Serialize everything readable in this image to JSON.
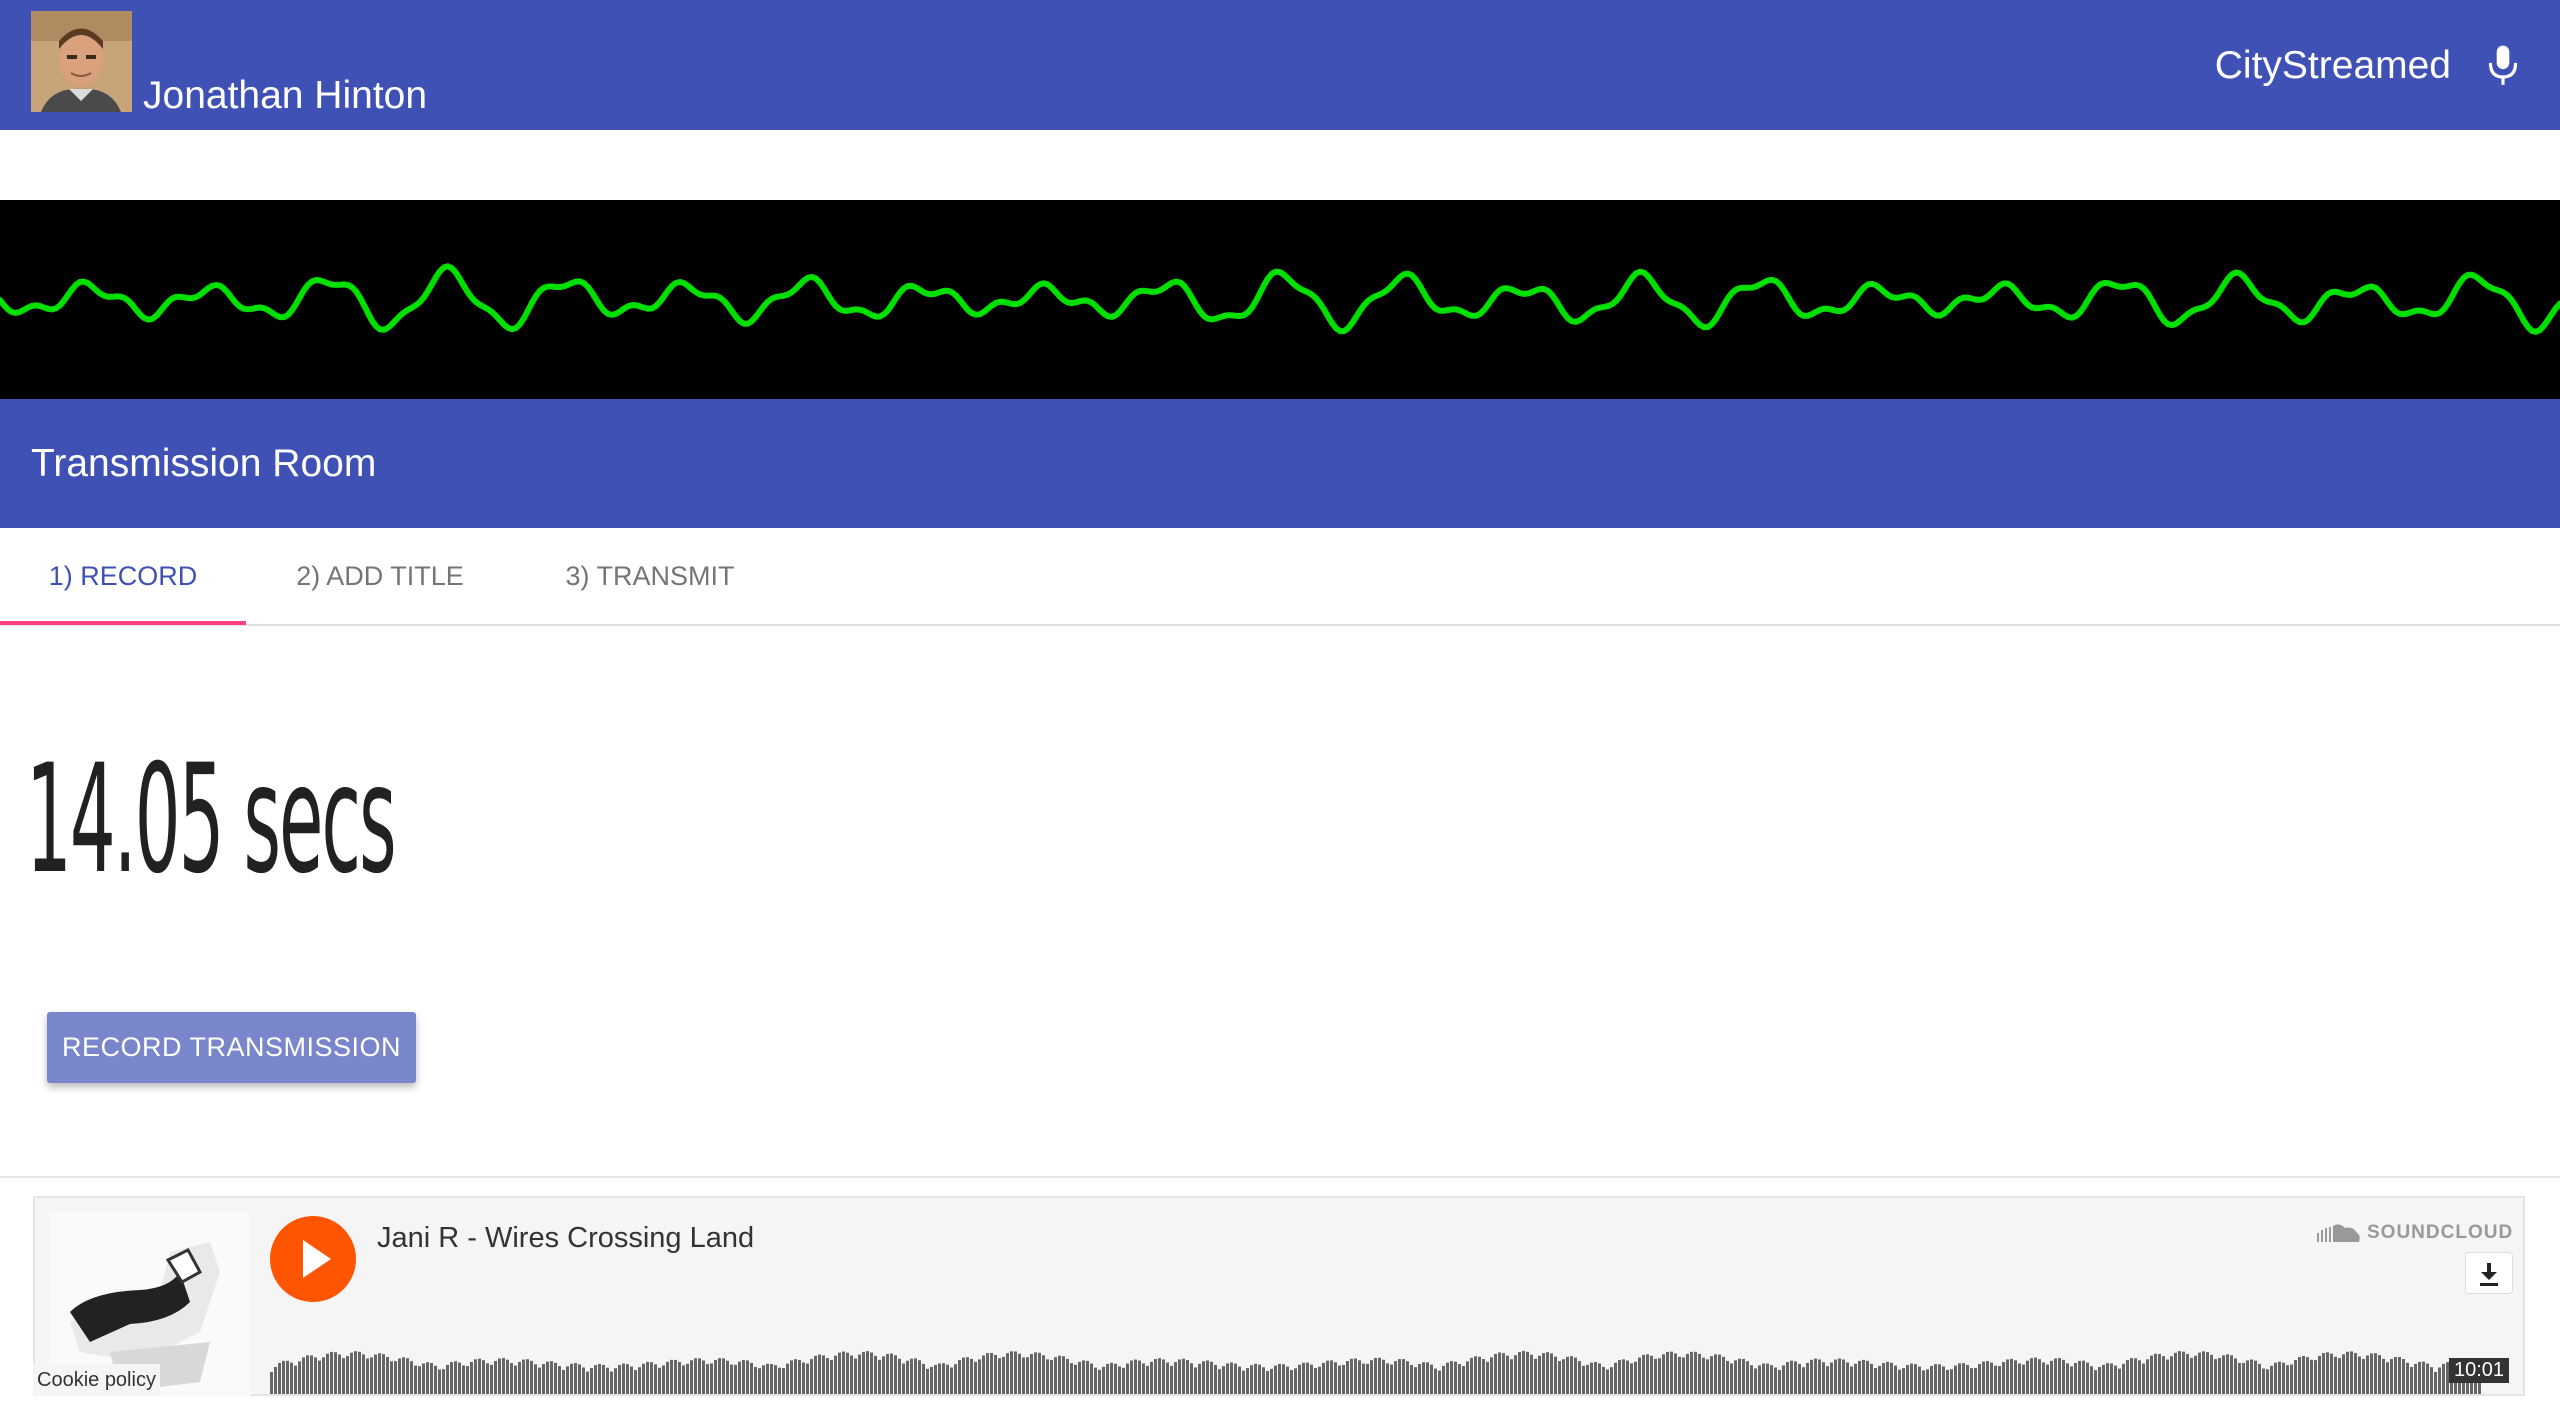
{
  "header": {
    "user_name": "Jonathan Hinton",
    "app_name": "CityStreamed",
    "background_color": "#3f51b5",
    "mic_icon": "microphone-icon"
  },
  "visualizer": {
    "background_color": "#000000",
    "wave_color": "#00e000"
  },
  "room": {
    "title": "Transmission Room"
  },
  "tabs": [
    {
      "label": "1) RECORD",
      "active": true
    },
    {
      "label": "2) ADD TITLE",
      "active": false
    },
    {
      "label": "3) TRANSMIT",
      "active": false
    }
  ],
  "tab_indicator_color": "#ff4081",
  "timer": {
    "text": "14.05 secs"
  },
  "record_button": {
    "label": "RECORD TRANSMISSION",
    "color": "#7986cb"
  },
  "soundcloud": {
    "track": "Jani R - Wires Crossing Land",
    "brand": "SOUNDCLOUD",
    "duration": "10:01",
    "play_color": "#ff5500",
    "download_icon": "download-icon",
    "brand_icon": "soundcloud-cloud-icon"
  },
  "footer": {
    "cookie_policy": "Cookie policy"
  }
}
